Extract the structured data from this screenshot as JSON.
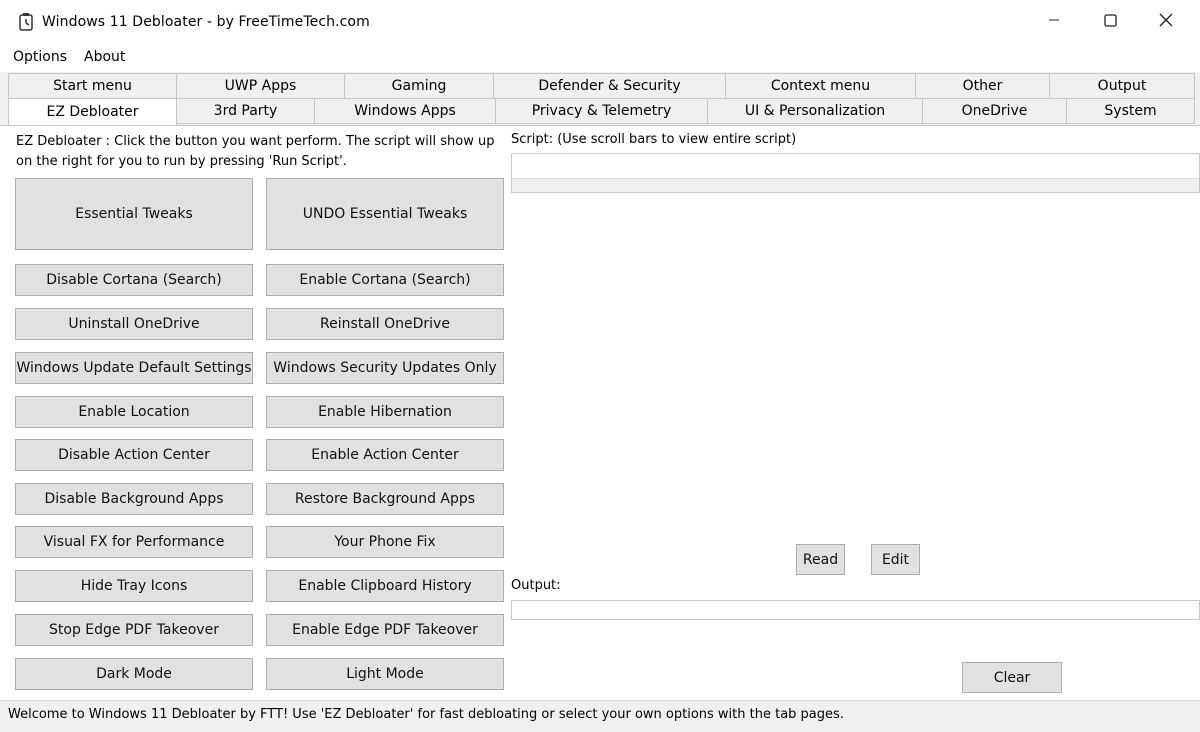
{
  "window": {
    "title": "Windows 11 Debloater - by FreeTimeTech.com",
    "icon": "app-logo-icon",
    "controls": [
      "minimize-icon",
      "maximize-icon",
      "close-icon"
    ]
  },
  "menubar": {
    "items": [
      "Options",
      "About"
    ]
  },
  "tabs": {
    "row1": [
      "Start menu",
      "UWP Apps",
      "Gaming",
      "Defender & Security",
      "Context menu",
      "Other",
      "Output"
    ],
    "row2": [
      "EZ Debloater",
      "3rd Party",
      "Windows Apps",
      "Privacy & Telemetry",
      "UI & Personalization",
      "OneDrive",
      "System"
    ],
    "active": "EZ Debloater"
  },
  "ez": {
    "description": "EZ Debloater : Click the button you want perform. The script will show up on the right for you to run by pressing 'Run Script'.",
    "buttons_left": [
      "Essential Tweaks",
      "Disable Cortana (Search)",
      "Uninstall OneDrive",
      "Windows Update Default Settings",
      "Enable Location",
      "Disable Action Center",
      "Disable Background Apps",
      "Visual FX for Performance",
      "Hide Tray Icons",
      "Stop Edge PDF Takeover",
      "Dark Mode"
    ],
    "buttons_right": [
      "UNDO Essential Tweaks",
      "Enable Cortana (Search)",
      "Reinstall OneDrive",
      "Windows Security Updates Only",
      "Enable Hibernation",
      "Enable Action Center",
      "Restore Background Apps",
      "Your Phone Fix",
      "Enable Clipboard History",
      "Enable Edge PDF Takeover",
      "Light Mode"
    ]
  },
  "script": {
    "label": "Script: (Use scroll bars to view entire script)",
    "read_label": "Read",
    "edit_label": "Edit"
  },
  "output": {
    "label": "Output:",
    "clear_label": "Clear"
  },
  "status": {
    "text": "Welcome to Windows 11 Debloater by FTT! Use 'EZ Debloater' for fast debloating or select your own options with the tab pages."
  },
  "colors": {
    "window_bg": "#f0f0f0",
    "button_bg": "#e1e1e1",
    "button_border": "#adadad",
    "content_bg": "#ffffff"
  }
}
